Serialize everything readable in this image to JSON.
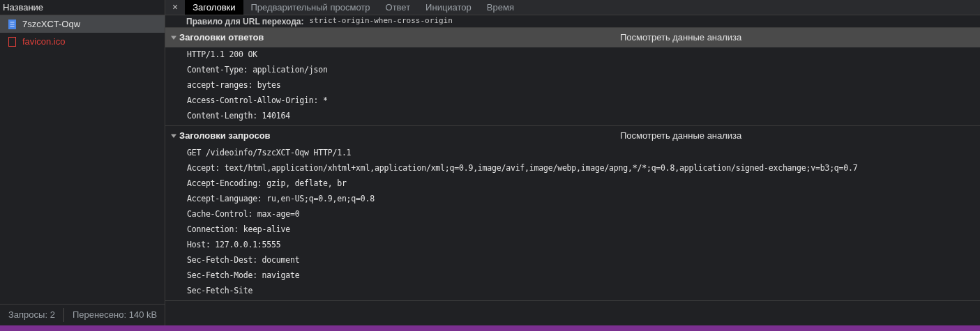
{
  "sidebar": {
    "header": "Название",
    "items": [
      {
        "name": "7szcXCT-Oqw",
        "kind": "document",
        "selected": true,
        "failed": false
      },
      {
        "name": "favicon.ico",
        "kind": "file",
        "selected": false,
        "failed": true
      }
    ],
    "status": [
      "Запросы: 2",
      "Перенесено: 140 kB"
    ]
  },
  "close_label": "×",
  "tabs": [
    {
      "label": "Заголовки",
      "kind": "tab",
      "selected": true
    },
    {
      "label": "Предварительный просмотр",
      "kind": "tab",
      "selected": false
    },
    {
      "label": "Ответ",
      "kind": "tab",
      "selected": false
    },
    {
      "label": "Инициатор",
      "kind": "tab",
      "selected": false
    },
    {
      "label": "Время",
      "kind": "tab",
      "selected": false
    }
  ],
  "general_line": {
    "label": "Правило для URL перехода:",
    "value": "strict-origin-when-cross-origin"
  },
  "sections": [
    {
      "title": "Заголовки ответов",
      "link": "Посмотреть данные анализа",
      "expanded": true,
      "highlighted": true,
      "lines": [
        "HTTP/1.1 200 OK",
        "Content-Type: application/json",
        "accept-ranges: bytes",
        "Access-Control-Allow-Origin: *",
        "Content-Length: 140164"
      ]
    },
    {
      "title": "Заголовки запросов",
      "link": "Посмотреть данные анализа",
      "expanded": true,
      "highlighted": false,
      "lines": [
        "GET /videoinfo/7szcXCT-Oqw HTTP/1.1",
        "Accept: text/html,application/xhtml+xml,application/xml;q=0.9,image/avif,image/webp,image/apng,*/*;q=0.8,application/signed-exchange;v=b3;q=0.7",
        "Accept-Encoding: gzip, deflate, br",
        "Accept-Language: ru,en-US;q=0.9,en;q=0.8",
        "Cache-Control: max-age=0",
        "Connection: keep-alive",
        "Host: 127.0.0.1:5555",
        "Sec-Fetch-Dest: document",
        "Sec-Fetch-Mode: navigate",
        "Sec-Fetch-Site"
      ]
    }
  ]
}
